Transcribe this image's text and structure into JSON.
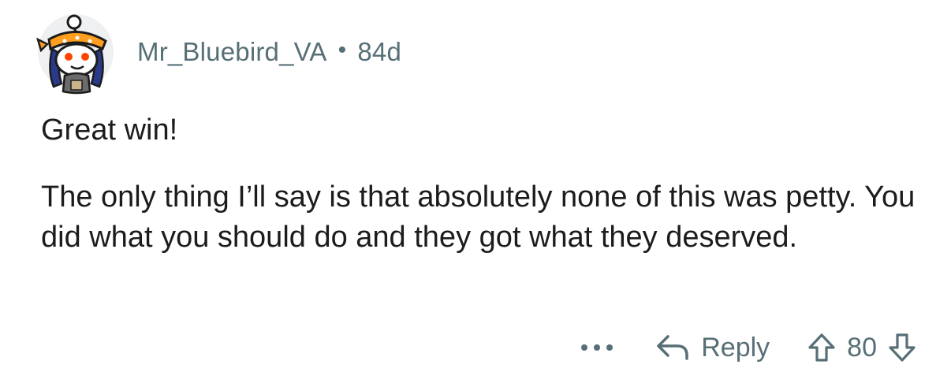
{
  "comment": {
    "author": "Mr_Bluebird_VA",
    "separator": "•",
    "age": "84d",
    "body": [
      "Great win!",
      "The only thing I’ll say is that absolutely none of this was petty. You did what you should do and they got what they deserved."
    ],
    "actions": {
      "more_label": "···",
      "reply_label": "Reply",
      "score": "80"
    }
  },
  "icons": {
    "more": "ellipsis-icon",
    "reply": "reply-arrow-icon",
    "upvote": "upvote-arrow-icon",
    "downvote": "downvote-arrow-icon"
  },
  "colors": {
    "text": "#1c1c1c",
    "meta": "#576f76",
    "avatar_bg": "#eef0f2"
  }
}
